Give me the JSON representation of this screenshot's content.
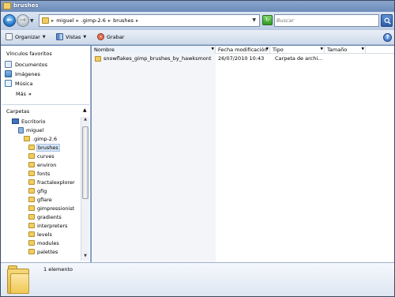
{
  "window": {
    "title": "brushes"
  },
  "address": {
    "crumbs": [
      "miguel",
      ".gimp-2.6",
      "brushes"
    ],
    "separator": "▸"
  },
  "search": {
    "placeholder": "Buscar"
  },
  "toolbar": {
    "organizar": "Organizar",
    "vistas": "Vistas",
    "grabar": "Grabar"
  },
  "favorites": {
    "heading": "Vínculos favoritos",
    "items": [
      "Documentos",
      "Imágenes",
      "Música"
    ],
    "more": "Más",
    "more_chevron": "»"
  },
  "folders": {
    "heading": "Carpetas",
    "tree": [
      {
        "label": "Escritorio",
        "icon": "desktop-icon"
      },
      {
        "label": "miguel",
        "icon": "user-folder-icon"
      },
      {
        "label": ".gimp-2.6",
        "icon": "folder-icon"
      },
      {
        "label": "brushes",
        "icon": "folder-icon",
        "selected": true
      },
      {
        "label": "curves",
        "icon": "folder-icon"
      },
      {
        "label": "environ",
        "icon": "folder-icon"
      },
      {
        "label": "fonts",
        "icon": "folder-icon"
      },
      {
        "label": "fractalexplorer",
        "icon": "folder-icon"
      },
      {
        "label": "gfig",
        "icon": "folder-icon"
      },
      {
        "label": "gflare",
        "icon": "folder-icon"
      },
      {
        "label": "gimpressionist",
        "icon": "folder-icon"
      },
      {
        "label": "gradients",
        "icon": "folder-icon"
      },
      {
        "label": "interpreters",
        "icon": "folder-icon"
      },
      {
        "label": "levels",
        "icon": "folder-icon"
      },
      {
        "label": "modules",
        "icon": "folder-icon"
      },
      {
        "label": "palettes",
        "icon": "folder-icon"
      }
    ]
  },
  "columns": {
    "name": "Nombre",
    "date": "Fecha modificación",
    "type": "Tipo",
    "size": "Tamaño"
  },
  "files": [
    {
      "name": "snowflakes_gimp_brushes_by_hawksmont",
      "date": "26/07/2010 10:43",
      "type": "Carpeta de archi...",
      "size": ""
    }
  ],
  "details": {
    "count": "1 elemento"
  },
  "colors": {
    "title_bar": "#7594c2",
    "selection": "#d6e5f5",
    "folder": "#f1ce63"
  }
}
